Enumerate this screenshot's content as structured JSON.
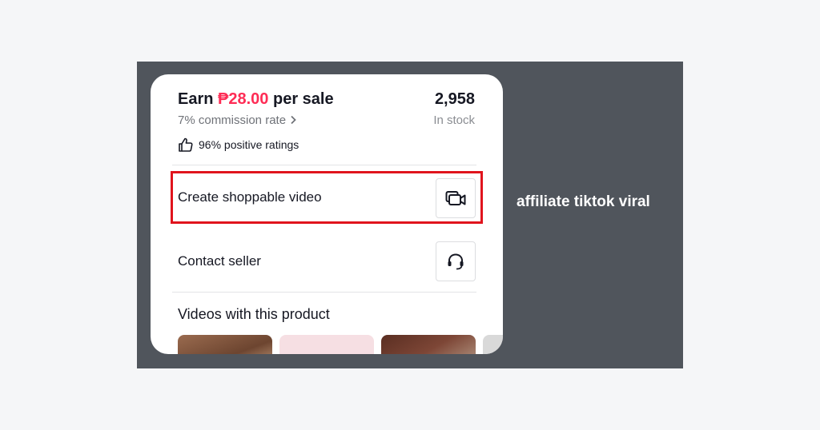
{
  "card": {
    "earn_prefix": "Earn",
    "earn_amount": "₱28.00",
    "earn_suffix": "per sale",
    "commission": "7% commission rate",
    "stock_count": "2,958",
    "stock_label": "In stock",
    "rating": "96% positive ratings",
    "create_video_label": "Create shoppable video",
    "contact_seller_label": "Contact seller",
    "videos_section_title": "Videos with this product"
  },
  "caption": "affiliate tiktok viral",
  "icons": {
    "thumbs_up": "thumbs-up-icon",
    "chevron": "chevron-right-icon",
    "video": "video-camera-icon",
    "headset": "headset-icon"
  },
  "colors": {
    "accent": "#fe2c55",
    "highlight_border": "#e0141d",
    "panel": "#50555c",
    "background": "#f5f6f8"
  }
}
